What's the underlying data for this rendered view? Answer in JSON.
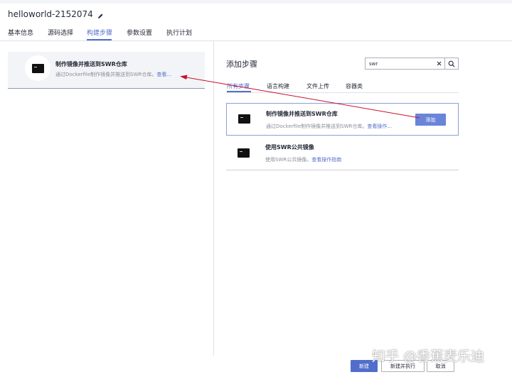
{
  "project": {
    "name": "helloworld-2152074",
    "edit_icon": "pencil-icon"
  },
  "tabs": [
    {
      "label": "基本信息"
    },
    {
      "label": "源码选择"
    },
    {
      "label": "构建步骤",
      "active": true
    },
    {
      "label": "参数设置"
    },
    {
      "label": "执行计划"
    }
  ],
  "selected_step": {
    "title": "制作镜像并推送到SWR仓库",
    "desc_prefix": "通过Dockerfile制作镜像并推送到SWR仓库。",
    "desc_link": "查看...",
    "icon": "terminal-icon"
  },
  "add_panel": {
    "title": "添加步骤",
    "search": {
      "value": "swr",
      "clear_icon": "close-icon",
      "search_icon": "search-icon"
    },
    "subtabs": [
      {
        "label": "所有步骤",
        "active": true
      },
      {
        "label": "语言构建"
      },
      {
        "label": "文件上传"
      },
      {
        "label": "容器类"
      }
    ],
    "steps": [
      {
        "title": "制作镜像并推送到SWR仓库",
        "desc": "通过Dockerfile制作镜像并推送到SWR仓库。",
        "link": "查看操作...",
        "button": "添加",
        "icon": "terminal-icon"
      },
      {
        "title": "使用SWR公共镜像",
        "desc": "使用SWR公共镜像。",
        "link": "查看操作指南",
        "icon": "terminal-icon"
      }
    ]
  },
  "footer": {
    "create": "新建",
    "create_run": "新建并执行",
    "cancel": "取消"
  },
  "watermark": "知乎 @香蕉麦乐迪",
  "colors": {
    "accent": "#526ecc",
    "arrow": "#c8102e",
    "button": "#6a84d9"
  }
}
